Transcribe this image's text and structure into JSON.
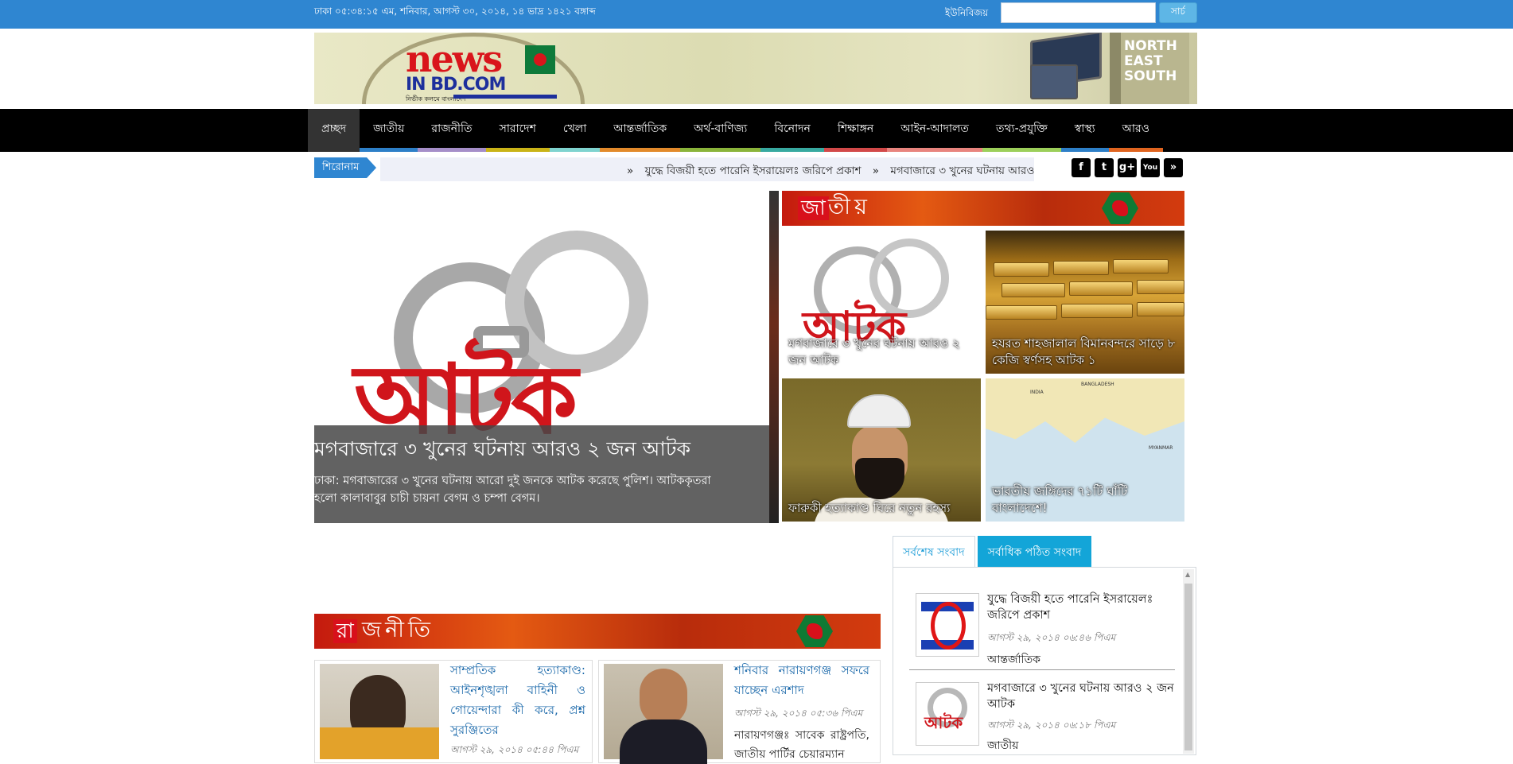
{
  "topbar": {
    "date": "ঢাকা ০৫:৩৪:১৫ এম, শনিবার, আগস্ট ৩০, ২০১৪, ১৪ ভাদ্র ১৪২১ বঙ্গাব্দ",
    "unicode_label": "ইউনিবিজয়",
    "search_placeholder": "",
    "search_button": "সার্চ"
  },
  "banner": {
    "logo_news": "news",
    "logo_bd": "IN BD.COM",
    "logo_tagline": "নির্ভীক কলমে বাংলাদেশ",
    "ad_text": "NORTH EAST SOUTH"
  },
  "nav": {
    "items": [
      {
        "label": "প্রচ্ছদ",
        "color": "#333333"
      },
      {
        "label": "জাতীয়",
        "color": "#2d7fc7"
      },
      {
        "label": "রাজনীতি",
        "color": "#a58ec8"
      },
      {
        "label": "সারাদেশ",
        "color": "#c9b317"
      },
      {
        "label": "খেলা",
        "color": "#7fd3cf"
      },
      {
        "label": "আন্তর্জাতিক",
        "color": "#e28a2b"
      },
      {
        "label": "অর্থ-বাণিজ্য",
        "color": "#8ab43a"
      },
      {
        "label": "বিনোদন",
        "color": "#37a9a0"
      },
      {
        "label": "শিক্ষাঙ্গন",
        "color": "#d24949"
      },
      {
        "label": "আইন-আদালত",
        "color": "#e8847e"
      },
      {
        "label": "তথ্য-প্রযুক্তি",
        "color": "#9ccf5a"
      },
      {
        "label": "স্বাস্থ্য",
        "color": "#2d7fc7"
      },
      {
        "label": "আরও",
        "color": "#e0641f"
      }
    ]
  },
  "ticker": {
    "label": "শিরোনাম",
    "items": [
      "যুদ্ধে বিজয়ী হতে পারেনি ইসরায়েলঃ জরিপে প্রকাশ",
      "মগবাজারে ৩ খুনের ঘটনায় আরও"
    ]
  },
  "social": {
    "icons": [
      "facebook-icon",
      "twitter-icon",
      "google-plus-icon",
      "youtube-icon",
      "rss-icon"
    ],
    "glyphs": [
      "f",
      "t",
      "g+",
      "You",
      "»"
    ]
  },
  "slider": {
    "image_text": "আটক",
    "headline": "মগবাজারে ৩ খুনের ঘটনায় আরও ২ জন আটক",
    "summary": "ঢাকা: মগবাজারের ৩ খুনের ঘটনায় আরো দুই জনকে আটক করেছে পুলিশ। আটককৃতরা হলো কালাবাবুর চাচী চায়না বেগম ও চম্পা বেগম।"
  },
  "jatiyo": {
    "head_first": "জা",
    "head_rest": "তীয়",
    "tiles": [
      {
        "image_text": "আটক",
        "caption": "মগবাজারে ৩ খুনের ঘটনায় আরও ২ জন আটক"
      },
      {
        "caption": "হযরত শাহজালাল বিমানবন্দরে সাড়ে ৮ কেজি স্বর্ণসহ আটক ১"
      },
      {
        "caption": "ফারুকী হত্যাকাণ্ড ঘিরে নতুন রহস্য"
      },
      {
        "map_labels": [
          "INDIA",
          "BANGLADESH",
          "MYANMAR"
        ],
        "caption": "ভারতীয় জঙ্গিদের ৭১টি ঘাঁটি বাংলাদেশে!"
      }
    ]
  },
  "rajniti": {
    "head_first": "রা",
    "head_rest": "জনীতি",
    "cards": [
      {
        "title": "সাম্প্রতিক হত্যাকাণ্ড: আইনশৃঙ্খলা বাহিনী ও গোয়েন্দারা কী করে, প্রশ্ন সুরঞ্জিতের",
        "date": "আগস্ট ২৯, ২০১৪ ০৫:৪৪ পিএম"
      },
      {
        "title": "শনিবার নারায়ণগঞ্জ সফরে যাচ্ছেন এরশাদ",
        "date": "আগস্ট ২৯, ২০১৪ ০৫:৩৬ পিএম",
        "body": "নারায়ণগঞ্জঃ সাবেক রাষ্ট্রপতি, জাতীয় পার্টির চেয়ারম্যান"
      }
    ]
  },
  "tabs": {
    "latest": "সর্বশেষ সংবাদ",
    "most_read": "সর্বাধিক পঠিত সংবাদ",
    "items": [
      {
        "title": "যুদ্ধে বিজয়ী হতে পারেনি ইসরায়েলঃ জরিপে প্রকাশ",
        "date": "আগস্ট ২৯, ২০১৪ ০৬:৪৬ পিএম",
        "category": "আন্তর্জাতিক"
      },
      {
        "image_text": "আটক",
        "title": "মগবাজারে ৩ খুনের ঘটনায় আরও ২ জন আটক",
        "date": "আগস্ট ২৯, ২০১৪ ০৬:১৮ পিএম",
        "category": "জাতীয়"
      }
    ]
  }
}
